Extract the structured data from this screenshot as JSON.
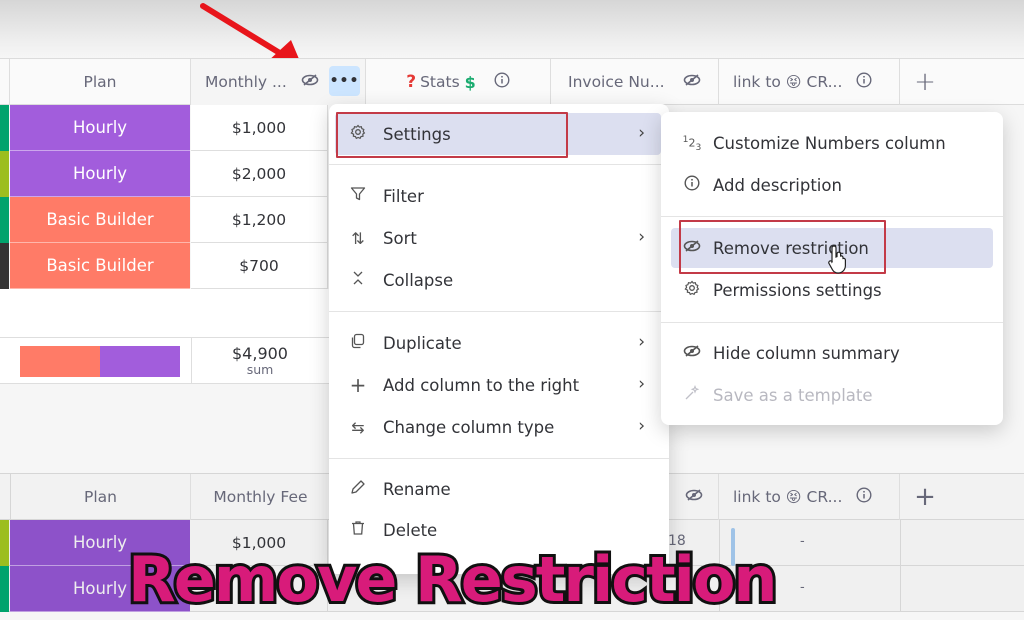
{
  "header": {
    "columns": [
      {
        "label": "Plan"
      },
      {
        "label": "Monthly ...",
        "icon": "eye-off-icon"
      },
      {
        "label": "Stats",
        "prefix_emoji": "❓",
        "suffix_emoji": "$",
        "icon": "info-icon"
      },
      {
        "label": "Invoice Nu...",
        "icon": "eye-off-icon"
      },
      {
        "label": "link to",
        "emoji": "😝",
        "label_suffix": "CR...",
        "icon": "info-icon"
      },
      {
        "label": "+"
      }
    ],
    "more_button": "•••"
  },
  "rows": [
    {
      "plan": "Hourly",
      "fee": "$1,000",
      "plan_color": "#a25ddc",
      "marker_color": "#00a36c"
    },
    {
      "plan": "Hourly",
      "fee": "$2,000",
      "plan_color": "#a25ddc",
      "marker_color": "#9cbe1f"
    },
    {
      "plan": "Basic Builder",
      "fee": "$1,200",
      "plan_color": "#ff7b67",
      "marker_color": "#00a36c"
    },
    {
      "plan": "Basic Builder",
      "fee": "$700",
      "plan_color": "#ff7b67",
      "marker_color": "#333333"
    }
  ],
  "summary": {
    "value": "$4,900",
    "label": "sum",
    "distribution": [
      {
        "plan": "Basic Builder",
        "fraction": 0.5,
        "color": "#ff7b67"
      },
      {
        "plan": "Hourly",
        "fraction": 0.5,
        "color": "#a25ddc"
      }
    ]
  },
  "context_menu": {
    "items": [
      {
        "label": "Settings",
        "icon": "gear-icon",
        "has_submenu": true,
        "active": true
      },
      {
        "label": "Filter",
        "icon": "filter-icon"
      },
      {
        "label": "Sort",
        "icon": "sort-icon",
        "has_submenu": true
      },
      {
        "label": "Collapse",
        "icon": "collapse-icon"
      },
      {
        "label": "Duplicate",
        "icon": "duplicate-icon",
        "has_submenu": true
      },
      {
        "label": "Add column to the right",
        "icon": "plus-icon",
        "has_submenu": true
      },
      {
        "label": "Change column type",
        "icon": "swap-icon",
        "has_submenu": true
      },
      {
        "label": "Rename",
        "icon": "pencil-icon"
      },
      {
        "label": "Delete",
        "icon": "trash-icon"
      }
    ]
  },
  "settings_submenu": {
    "items": [
      {
        "label": "Customize Numbers column",
        "icon": "numbers-icon"
      },
      {
        "label": "Add description",
        "icon": "info-icon"
      },
      {
        "label": "Remove restriction",
        "icon": "eye-off-icon",
        "active": true
      },
      {
        "label": "Permissions settings",
        "icon": "gear-icon"
      },
      {
        "label": "Hide column summary",
        "icon": "eye-off-icon"
      },
      {
        "label": "Save as a template",
        "icon": "magic-wand-icon",
        "disabled": true
      }
    ]
  },
  "bottom_group": {
    "columns": [
      {
        "label": "Plan"
      },
      {
        "label": "Monthly Fee"
      },
      {
        "label": "link to",
        "emoji": "😝",
        "label_suffix": "CR...",
        "icon": "info-icon"
      },
      {
        "label": "+"
      }
    ],
    "rows": [
      {
        "plan": "Hourly",
        "fee": "$1,000",
        "partial_number": "18",
        "link": "-",
        "marker_color": "#9cbe1f"
      },
      {
        "plan": "Hourly",
        "fee": "",
        "link": "-",
        "marker_color": "#00a36c"
      }
    ]
  },
  "caption": "Remove Restriction",
  "colors": {
    "hourly": "#a25ddc",
    "basic_builder": "#ff7b67",
    "highlight_box": "#c33a47",
    "caption": "#d81b7a",
    "menu_active": "#dcdff0"
  }
}
